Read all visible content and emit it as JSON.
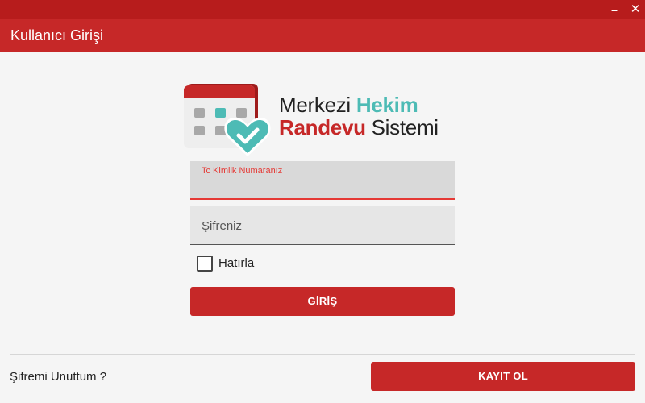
{
  "window": {
    "minimize_glyph": "–",
    "close_glyph": "✕"
  },
  "header": {
    "title": "Kullanıcı Girişi"
  },
  "logo": {
    "word1": "Merkezi",
    "word2": "Hekim",
    "word3": "Randevu",
    "word4": "Sistemi",
    "colors": {
      "red": "#c62828",
      "teal": "#4dbbb5",
      "dark": "#222222"
    },
    "icon": "calendar-heart-check-icon"
  },
  "form": {
    "tc_label": "Tc Kimlik Numaranız",
    "tc_value": "",
    "password_placeholder": "Şifreniz",
    "password_value": "",
    "remember_label": "Hatırla",
    "remember_checked": false,
    "login_button": "GİRİŞ"
  },
  "footer": {
    "forgot_link": "Şifremi Unuttum ?",
    "register_button": "KAYIT OL"
  },
  "colors": {
    "titlebar": "#b71c1c",
    "appbar": "#c62828",
    "accent": "#e53935",
    "background": "#f5f5f5"
  }
}
